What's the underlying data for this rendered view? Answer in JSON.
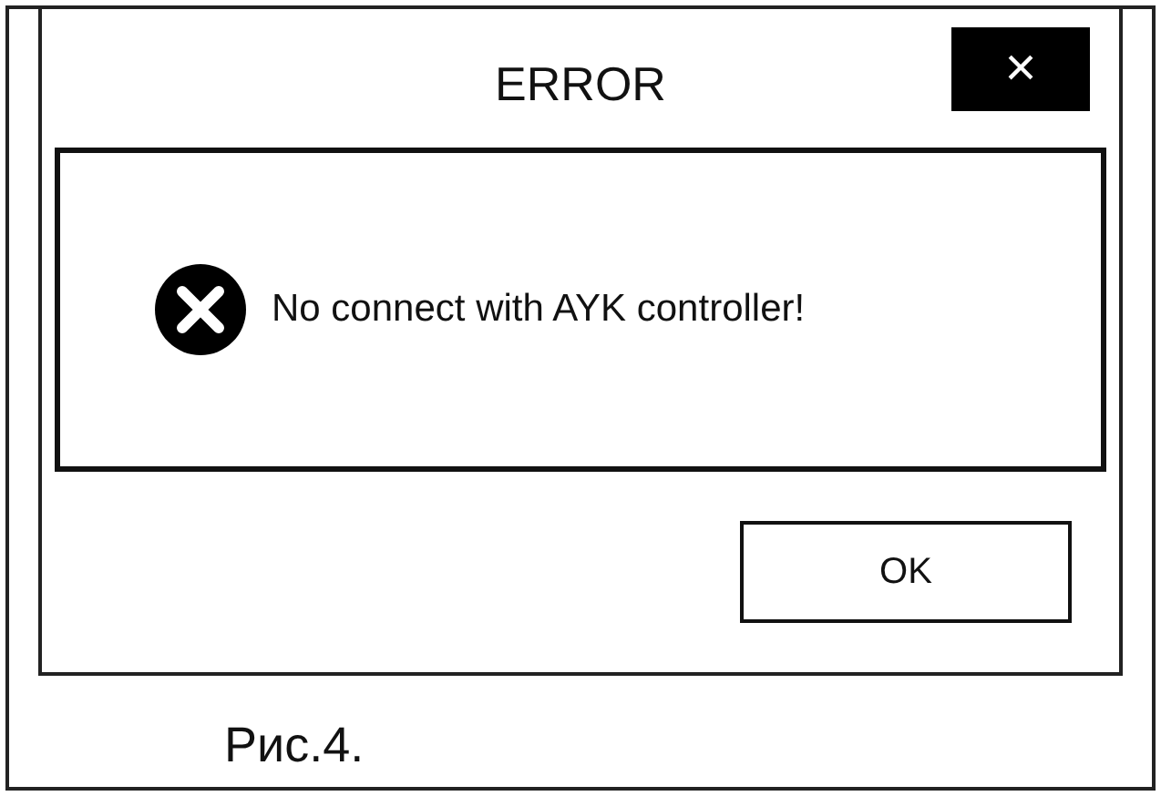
{
  "dialog": {
    "title": "ERROR",
    "close": "×",
    "message": "No connect with AYK controller!",
    "buttons": [
      {
        "label": "OK"
      }
    ]
  },
  "caption": "Рис.4."
}
